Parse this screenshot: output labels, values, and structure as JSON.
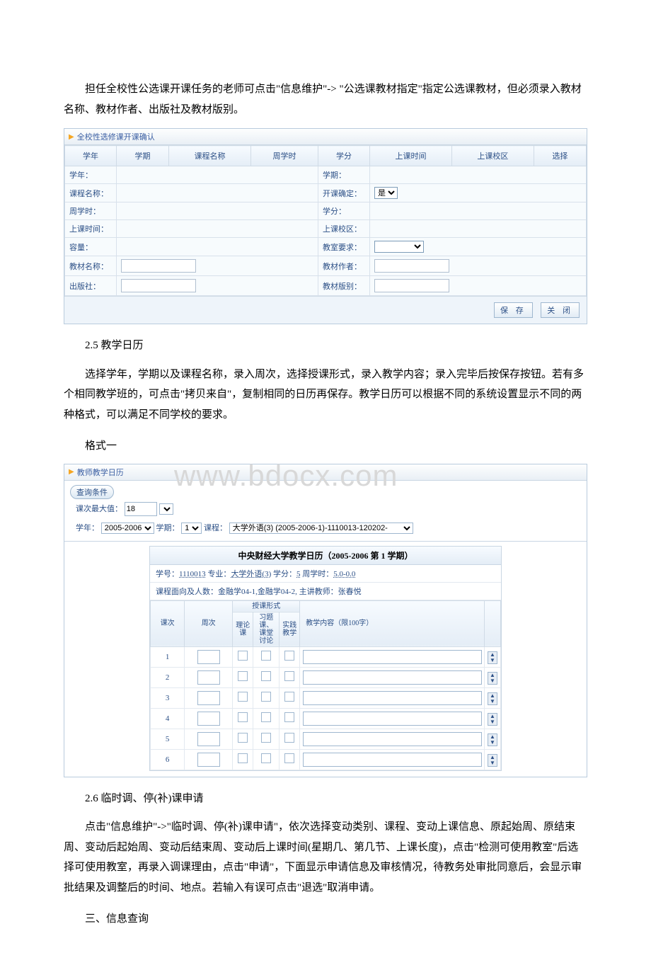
{
  "intro_para": "担任全校性公选课开课任务的老师可点击\"信息维护\"-> \"公选课教材指定\"指定公选课教材，但必须录入教材名称、教材作者、出版社及教材版别。",
  "screenshot1": {
    "panel_title": "全校性选修课开课确认",
    "headers": [
      "学年",
      "学期",
      "课程名称",
      "周学时",
      "学分",
      "上课时间",
      "上课校区",
      "选择"
    ],
    "rows": [
      [
        "学年：",
        "学期："
      ],
      [
        "课程名称：",
        "开课确定："
      ],
      [
        "周学时：",
        "学分："
      ],
      [
        "上课时间：",
        "上课校区："
      ],
      [
        "容量：",
        "教室要求："
      ],
      [
        "教材名称：",
        "教材作者："
      ],
      [
        "出版社：",
        "教材版别："
      ]
    ],
    "confirm_value": "是",
    "btn_save": "保 存",
    "btn_close": "关 闭"
  },
  "section_2_5_title": "2.5 教学日历",
  "section_2_5_para": "选择学年，学期以及课程名称，录入周次，选择授课形式，录入教学内容；录入完毕后按保存按钮。若有多个相同教学班的，可点击\"拷贝来自\"，复制相同的日历再保存。教学日历可以根据不同的系统设置显示不同的两种格式，可以满足不同学校的要求。",
  "format1_label": "格式一",
  "watermark": "www.bdocx.com",
  "screenshot2": {
    "panel_title": "教师教学日历",
    "query_badge": "查询条件",
    "label_max": "课次最大值：",
    "val_max": "18",
    "label_year": "学年：",
    "val_year": "2005-2006",
    "label_term": "学期：",
    "val_term": "1",
    "label_course": "课程：",
    "val_course": "大学外语(3) (2005-2006-1)-1110013-120202-",
    "cal_title": "中央财经大学教学日历（2005-2006 第 1 学期）",
    "meta_line1_a": "学号：",
    "meta_line1_b": "1110013",
    "meta_line1_c": " 专业：",
    "meta_line1_d": "大学外语(3)",
    "meta_line1_e": " 学分：",
    "meta_line1_f": "5",
    "meta_line1_g": " 周学时：",
    "meta_line1_h": "5.0-0.0",
    "meta_line2": "课程面向及人数：金融学04-1,金融学04-2,  主讲教师：张春悦",
    "grid_headers": {
      "c1": "课次",
      "c2": "周次",
      "grp": "授课形式",
      "g1": "理论课",
      "g2": "习题课、课堂讨论",
      "g3": "实践教学",
      "c_last": "教学内容（限100字）"
    },
    "grid_rows": [
      "1",
      "2",
      "3",
      "4",
      "5",
      "6"
    ]
  },
  "section_2_6_title": "2.6 临时调、停(补)课申请",
  "section_2_6_para": "点击\"信息维护\"->\"临时调、停(补)课申请\"，依次选择变动类别、课程、变动上课信息、原起始周、原结束周、变动后起始周、变动后结束周、变动后上课时间(星期几、第几节、上课长度)，点击\"检测可使用教室\"后选择可使用教室，再录入调课理由，点击\"申请\"，下面显示申请信息及审核情况，待教务处审批同意后，会显示审批结果及调整后的时间、地点。若输入有误可点击\"退选\"取消申请。",
  "section_3_title": "三、信息查询"
}
